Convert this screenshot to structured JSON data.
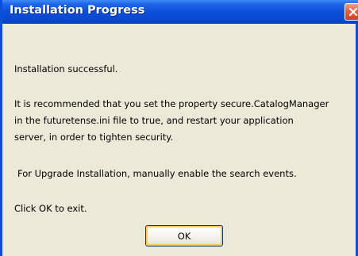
{
  "window": {
    "title": "Installation Progress"
  },
  "message": {
    "status": "Installation successful.",
    "recommendation_lines": [
      "It is recommended that you set the property secure.CatalogManager",
      "in the futuretense.ini file to true, and restart your application",
      "server, in order to tighten security."
    ],
    "upgrade_note": "For Upgrade Installation, manually enable the search events.",
    "exit_instruction": "Click OK to exit."
  },
  "buttons": {
    "ok_label": "OK"
  },
  "icons": {
    "close": "close-icon"
  },
  "colors": {
    "title_bar": "#0b4fd9",
    "close_button": "#e0603f",
    "dialog_background": "#ece9d8",
    "ok_focus_ring": "#f8c86a"
  }
}
